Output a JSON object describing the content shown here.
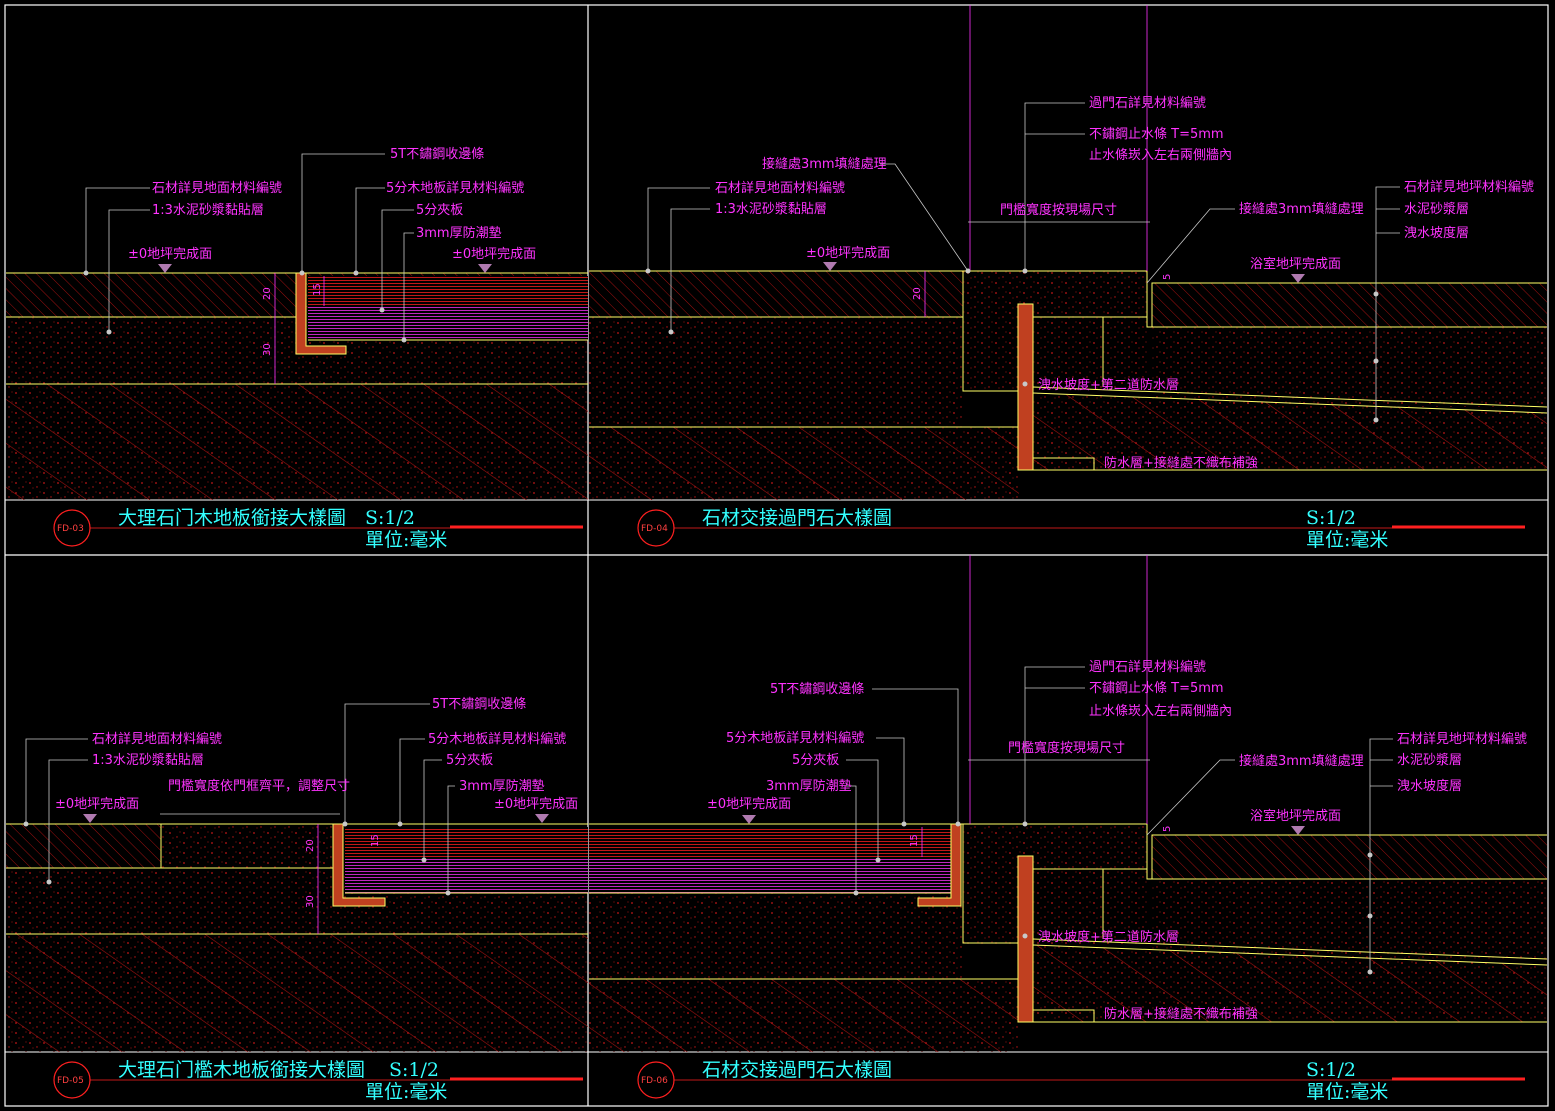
{
  "colors": {
    "border": "#ffffff",
    "yellow": "#ffff66",
    "magenta": "#ff33ff",
    "red": "#ff2020",
    "cyan": "#33ffff",
    "leader": "#c8c8c8"
  },
  "panels": [
    {
      "tag": "FD-03",
      "title": "大理石门木地板銜接大樣圖",
      "scale": "S:1/2",
      "unit": "單位:毫米",
      "labels": [
        "5T不鏽鋼收邊條",
        "石材詳見地面材料編號",
        "5分木地板詳見材料編號",
        "1:3水泥砂漿黏貼層",
        "5分夾板",
        "3mm厚防潮墊",
        "±0地坪完成面",
        "±0地坪完成面"
      ],
      "dims": [
        "20",
        "30",
        "15"
      ]
    },
    {
      "tag": "FD-04",
      "title": "石材交接過門石大樣圖",
      "scale": "S:1/2",
      "unit": "單位:毫米",
      "labels": [
        "過門石詳見材料編號",
        "不鏽鋼止水條 T=5mm",
        "止水條崁入左右兩側牆內",
        "接縫處3mm填縫處理",
        "石材詳見地面材料編號",
        "石材詳見地坪材料編號",
        "1:3水泥砂漿黏貼層",
        "門檻寬度按現場尺寸",
        "接縫處3mm填縫處理",
        "水泥砂漿層",
        "洩水坡度層",
        "±0地坪完成面",
        "浴室地坪完成面",
        "洩水坡度+第二道防水層",
        "防水層+接縫處不織布補強"
      ],
      "dims": [
        "20",
        "5"
      ]
    },
    {
      "tag": "FD-05",
      "title": "大理石门檻木地板銜接大樣圖",
      "scale": "S:1/2",
      "unit": "單位:毫米",
      "labels": [
        "5T不鏽鋼收邊條",
        "石材詳見地面材料編號",
        "5分木地板詳見材料編號",
        "1:3水泥砂漿黏貼層",
        "5分夾板",
        "門檻寬度依門框齊平，調整尺寸",
        "3mm厚防潮墊",
        "±0地坪完成面",
        "±0地坪完成面"
      ],
      "dims": [
        "20",
        "30",
        "15"
      ]
    },
    {
      "tag": "FD-06",
      "title": "石材交接過門石大樣圖",
      "scale": "S:1/2",
      "unit": "單位:毫米",
      "labels": [
        "過門石詳見材料編號",
        "5T不鏽鋼收邊條",
        "不鏽鋼止水條 T=5mm",
        "止水條崁入左右兩側牆內",
        "門檻寬度按現場尺寸",
        "5分木地板詳見材料編號",
        "石材詳見地坪材料編號",
        "5分夾板",
        "接縫處3mm填縫處理",
        "水泥砂漿層",
        "3mm厚防潮墊",
        "洩水坡度層",
        "±0地坪完成面",
        "浴室地坪完成面",
        "洩水坡度+第二道防水層",
        "防水層+接縫處不織布補強"
      ],
      "dims": [
        "15",
        "5"
      ]
    }
  ]
}
